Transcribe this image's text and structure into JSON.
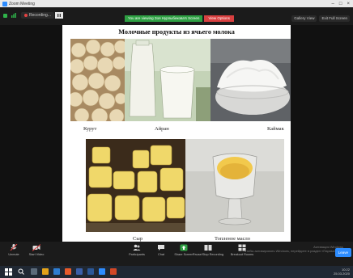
{
  "window": {
    "title": "Zoom Meeting"
  },
  "top": {
    "recording_label": "Recording...",
    "share_notice": "You are viewing Зоя Нурлыбекова's Screen",
    "share_action": "View Options",
    "right_buttons": [
      "Gallery View",
      "Exit Full Screen"
    ]
  },
  "slide": {
    "title": "Молочные продукты из ячьего молока",
    "captions": {
      "kurut": "Курут",
      "airan": "Айран",
      "kaimak": "Каймак",
      "syr": "Сыр",
      "maslo": "Топленое масло"
    }
  },
  "controls": {
    "unmute": "Unmute",
    "start_video": "Start Video",
    "participants": "Participants",
    "participants_count": "27",
    "chat": "Chat",
    "share_screen": "Share Screen",
    "pause_recording": "Pause/Stop Recording",
    "breakout": "Breakout Rooms",
    "leave": "Leave"
  },
  "watermark": [
    "Активация Windows",
    "Чтобы активировать Windows, перейдите в раздел «Параметры»."
  ],
  "tray": {
    "time": "10:22",
    "date": "25.03.2020"
  },
  "colors": {
    "zoom_blue": "#2d8cff",
    "share_green": "#2ea043",
    "stop_red": "#d94040"
  }
}
